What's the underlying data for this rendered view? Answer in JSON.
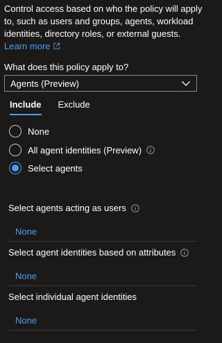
{
  "intro": {
    "text": "Control access based on who the policy will apply to, such as users and groups, agents, workload identities, directory roles, or external guests.",
    "link_label": "Learn more"
  },
  "question": "What does this policy apply to?",
  "dropdown": {
    "selected": "Agents (Preview)"
  },
  "tabs": [
    {
      "label": "Include",
      "active": true
    },
    {
      "label": "Exclude",
      "active": false
    }
  ],
  "radio_options": [
    {
      "label": "None",
      "checked": false
    },
    {
      "label": "All agent identities (Preview)",
      "checked": false,
      "info": true
    },
    {
      "label": "Select agents",
      "checked": true
    }
  ],
  "sections": [
    {
      "title": "Select agents acting as users",
      "value": "None",
      "info": true
    },
    {
      "title": "Select agent identities based on attributes",
      "value": "None",
      "info": true
    },
    {
      "title": "Select individual agent identities",
      "value": "None",
      "info": false
    }
  ],
  "colors": {
    "accent": "#479ef5",
    "background": "#1b1a19",
    "divider": "#3b3a39"
  },
  "icons": {
    "external": "open-in-new-icon",
    "chevron": "chevron-down-icon",
    "info": "info-icon"
  }
}
